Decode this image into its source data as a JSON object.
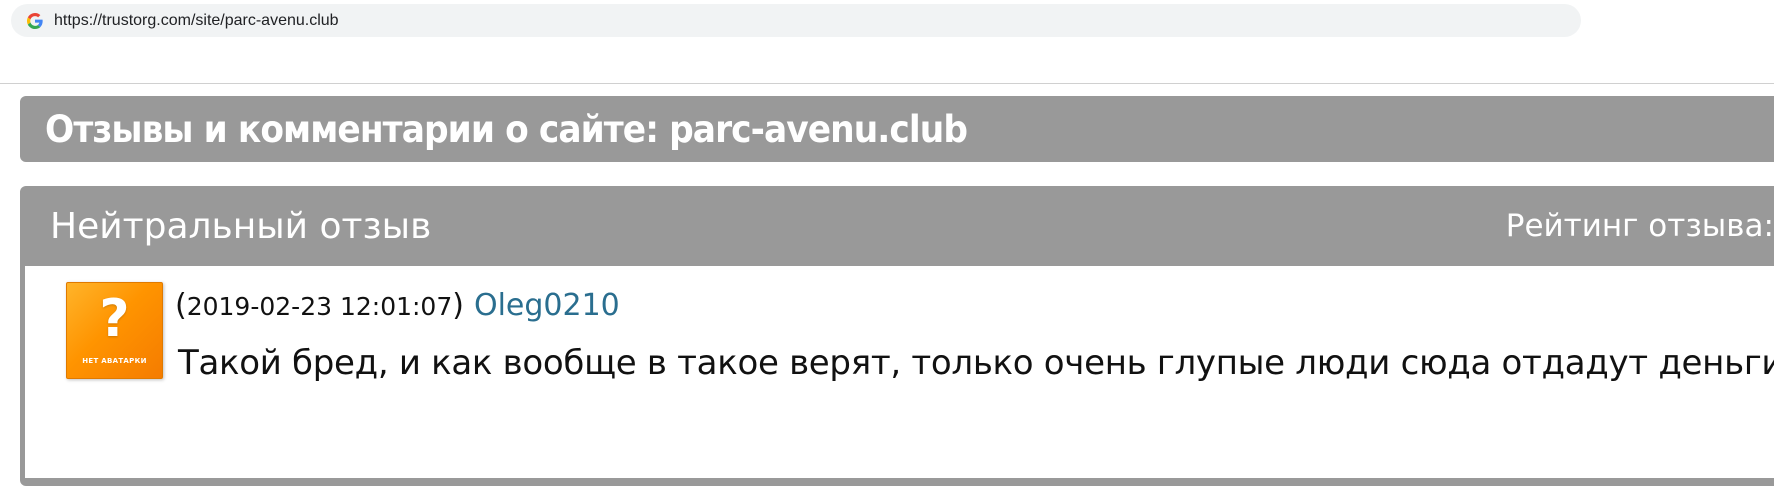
{
  "browser": {
    "url": "https://trustorg.com/site/parc-avenu.club",
    "favicon_icon": "google-g-icon"
  },
  "site_header": {
    "title": "Отзывы и комментарии о сайте: parc-avenu.club"
  },
  "review": {
    "type": "Нейтральный отзыв",
    "rating_label": "Рейтинг отзыва:",
    "avatar": {
      "symbol": "?",
      "caption": "НЕТ АВАТАРКИ",
      "icon": "no-avatar-icon"
    },
    "paren_open": "(",
    "date": "2019-02-23 12:01:07",
    "paren_close": ")",
    "author": "Oleg0210",
    "text": "Такой бред, и как вообще в такое верят, только очень глупые люди сюда отдадут деньги!"
  },
  "colors": {
    "header_bg": "#999999",
    "author_link": "#2a6e8f",
    "avatar_orange": "#ff9400"
  }
}
